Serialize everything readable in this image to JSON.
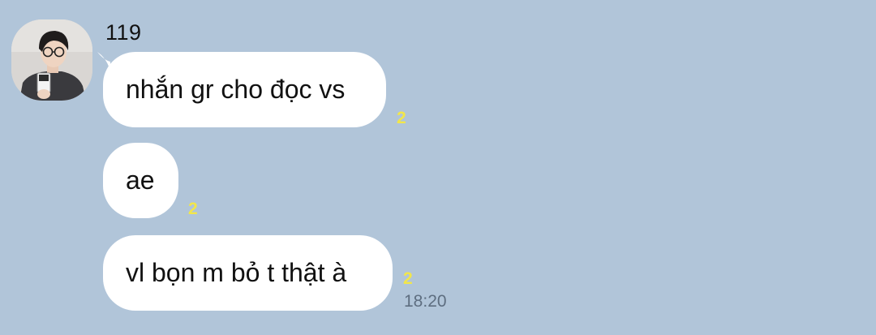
{
  "sender": {
    "name": "119"
  },
  "messages": [
    {
      "text": "nhắn gr cho đọc vs",
      "unread_count": "2"
    },
    {
      "text": "ae",
      "unread_count": "2"
    },
    {
      "text": "vl bọn m bỏ t thật à",
      "unread_count": "2",
      "time": "18:20"
    }
  ],
  "colors": {
    "background": "#b1c5d9",
    "bubble": "#ffffff",
    "unread_count": "#f2e64a",
    "timestamp": "#5e6e80"
  }
}
